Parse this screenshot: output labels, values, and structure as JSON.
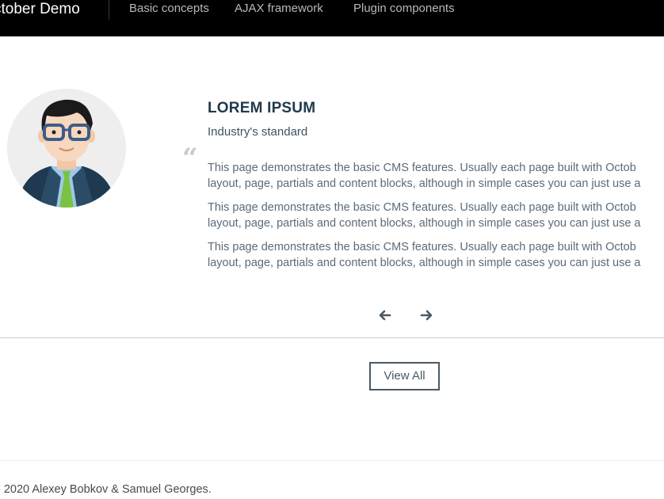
{
  "nav": {
    "brand": "ctober Demo",
    "items": [
      {
        "label": "Basic concepts"
      },
      {
        "label": "AJAX framework"
      },
      {
        "label": "Plugin components"
      }
    ]
  },
  "testimonial": {
    "title": "LOREM IPSUM",
    "subtitle": "Industry's standard",
    "quote_glyph": "“",
    "paragraphs": [
      {
        "line1": "This page demonstrates the basic CMS features. Usually each page built with Octob",
        "line2": "layout, page, partials and content blocks, although in simple cases you can just use a"
      },
      {
        "line1": "This page demonstrates the basic CMS features. Usually each page built with Octob",
        "line2": "layout, page, partials and content blocks, although in simple cases you can just use a"
      },
      {
        "line1": "This page demonstrates the basic CMS features. Usually each page built with Octob",
        "line2": "layout, page, partials and content blocks, although in simple cases you can just use a"
      }
    ],
    "prev_icon": "arrow-left-icon",
    "next_icon": "arrow-right-icon"
  },
  "view_all_label": "View All",
  "footer": {
    "copyright": "- 2020 Alexey Bobkov & Samuel Georges."
  },
  "colors": {
    "nav_bg": "#000000",
    "title": "#213a4b",
    "text": "#5b6b7a",
    "tie": "#7cc242",
    "suit": "#1f3a50"
  }
}
